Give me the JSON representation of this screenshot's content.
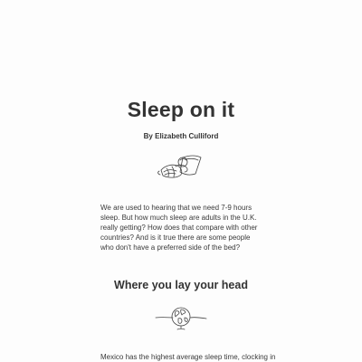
{
  "article": {
    "title": "Sleep on it",
    "byline": "By Elizabeth Culliford",
    "intro": "We are used to hearing that we need 7-9 hours sleep. But how much sleep are adults in the U.K. really getting? How does that compare with other countries? And is it true there are some people who don't have a preferred side of the bed?",
    "sections": [
      {
        "heading": "Where you lay your head",
        "text": "Mexico has the highest average sleep time, clocking in"
      }
    ]
  },
  "icons": {
    "sleeping_person": "sleeping-person-line-illustration",
    "globe": "globe-line-illustration"
  }
}
